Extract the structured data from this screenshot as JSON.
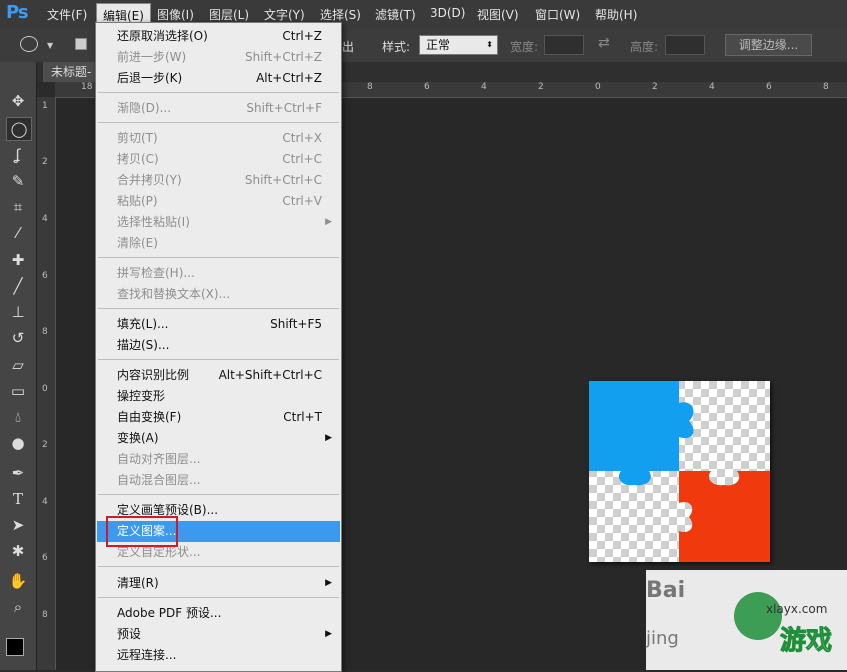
{
  "app": {
    "logo": "Ps"
  },
  "menubar": {
    "items": [
      "文件(F)",
      "编辑(E)",
      "图像(I)",
      "图层(L)",
      "文字(Y)",
      "选择(S)",
      "滤镜(T)",
      "3D(D)",
      "视图(V)",
      "窗口(W)",
      "帮助(H)"
    ]
  },
  "options_bar": {
    "partial_text": "出",
    "style_label": "样式:",
    "style_value": "正常",
    "width_label": "宽度:",
    "height_label": "高度:",
    "refine_edge_button": "调整边缘..."
  },
  "document_tab": {
    "title": "未标题-"
  },
  "ruler": {
    "h_labels": [
      "18",
      "8",
      "6",
      "4",
      "2",
      "0",
      "2",
      "4",
      "6",
      "8"
    ],
    "v_labels": [
      "1",
      "2",
      "4",
      "6",
      "8",
      "0",
      "2",
      "4",
      "6",
      "8"
    ]
  },
  "edit_menu": {
    "items": [
      {
        "label": "还原取消选择(O)",
        "shortcut": "Ctrl+Z",
        "disabled": false
      },
      {
        "label": "前进一步(W)",
        "shortcut": "Shift+Ctrl+Z",
        "disabled": true
      },
      {
        "label": "后退一步(K)",
        "shortcut": "Alt+Ctrl+Z",
        "disabled": false
      },
      {
        "label": "渐隐(D)...",
        "shortcut": "Shift+Ctrl+F",
        "disabled": true
      },
      {
        "label": "剪切(T)",
        "shortcut": "Ctrl+X",
        "disabled": true
      },
      {
        "label": "拷贝(C)",
        "shortcut": "Ctrl+C",
        "disabled": true
      },
      {
        "label": "合并拷贝(Y)",
        "shortcut": "Shift+Ctrl+C",
        "disabled": true
      },
      {
        "label": "粘贴(P)",
        "shortcut": "Ctrl+V",
        "disabled": true
      },
      {
        "label": "选择性粘贴(I)",
        "shortcut": "",
        "disabled": true,
        "submenu": true
      },
      {
        "label": "清除(E)",
        "shortcut": "",
        "disabled": true
      },
      {
        "label": "拼写检查(H)...",
        "shortcut": "",
        "disabled": true
      },
      {
        "label": "查找和替换文本(X)...",
        "shortcut": "",
        "disabled": true
      },
      {
        "label": "填充(L)...",
        "shortcut": "Shift+F5",
        "disabled": false
      },
      {
        "label": "描边(S)...",
        "shortcut": "",
        "disabled": false
      },
      {
        "label": "内容识别比例",
        "shortcut": "Alt+Shift+Ctrl+C",
        "disabled": false
      },
      {
        "label": "操控变形",
        "shortcut": "",
        "disabled": false
      },
      {
        "label": "自由变换(F)",
        "shortcut": "Ctrl+T",
        "disabled": false
      },
      {
        "label": "变换(A)",
        "shortcut": "",
        "disabled": false,
        "submenu": true
      },
      {
        "label": "自动对齐图层...",
        "shortcut": "",
        "disabled": true
      },
      {
        "label": "自动混合图层...",
        "shortcut": "",
        "disabled": true
      },
      {
        "label": "定义画笔预设(B)...",
        "shortcut": "",
        "disabled": false
      },
      {
        "label": "定义图案...",
        "shortcut": "",
        "disabled": false,
        "highlighted": true
      },
      {
        "label": "定义自定形状...",
        "shortcut": "",
        "disabled": true
      },
      {
        "label": "清理(R)",
        "shortcut": "",
        "disabled": false,
        "submenu": true
      },
      {
        "label": "Adobe PDF 预设...",
        "shortcut": "",
        "disabled": false
      },
      {
        "label": "预设",
        "shortcut": "",
        "disabled": false,
        "submenu": true
      },
      {
        "label": "远程连接...",
        "shortcut": "",
        "disabled": false
      }
    ]
  },
  "watermark": {
    "text_top": "Bai",
    "text_domain": "xlayx.com",
    "text_logo": "游戏",
    "text_bottom": "jing"
  },
  "colors": {
    "blue": "#129ff0",
    "orange": "#f03a0e",
    "highlight": "#3b9aed",
    "redbox": "#d0192a"
  }
}
